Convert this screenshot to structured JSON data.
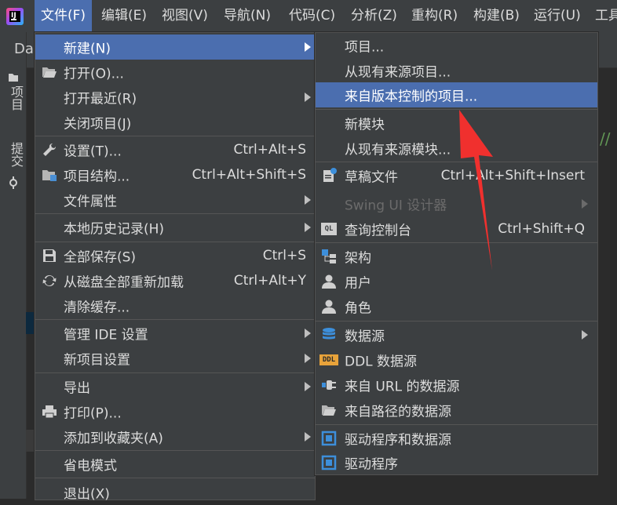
{
  "menubar": {
    "items": [
      "文件(F)",
      "编辑(E)",
      "视图(V)",
      "导航(N)",
      "代码(C)",
      "分析(Z)",
      "重构(R)",
      "构建(B)",
      "运行(U)",
      "工具"
    ]
  },
  "navbar": {
    "text": "Da"
  },
  "left_strip": {
    "tab_project": "项目",
    "tab_commit": "提交"
  },
  "editor": {
    "comment_fragment": "//"
  },
  "file_menu": {
    "items": [
      {
        "label": "新建(N)"
      },
      {
        "label": "打开(O)..."
      },
      {
        "label": "打开最近(R)"
      },
      {
        "label": "关闭项目(J)"
      },
      {
        "label": "设置(T)...",
        "shortcut": "Ctrl+Alt+S"
      },
      {
        "label": "项目结构...",
        "shortcut": "Ctrl+Alt+Shift+S"
      },
      {
        "label": "文件属性"
      },
      {
        "label": "本地历史记录(H)"
      },
      {
        "label": "全部保存(S)",
        "shortcut": "Ctrl+S"
      },
      {
        "label": "从磁盘全部重新加载",
        "shortcut": "Ctrl+Alt+Y"
      },
      {
        "label": "清除缓存..."
      },
      {
        "label": "管理 IDE 设置"
      },
      {
        "label": "新项目设置"
      },
      {
        "label": "导出"
      },
      {
        "label": "打印(P)..."
      },
      {
        "label": "添加到收藏夹(A)"
      },
      {
        "label": "省电模式"
      },
      {
        "label": "退出(X)"
      }
    ]
  },
  "new_menu": {
    "items": [
      {
        "label": "项目..."
      },
      {
        "label": "从现有来源项目..."
      },
      {
        "label": "来自版本控制的项目..."
      },
      {
        "label": "新模块"
      },
      {
        "label": "从现有来源模块..."
      },
      {
        "label": "草稿文件",
        "shortcut": "Ctrl+Alt+Shift+Insert"
      },
      {
        "label": "Swing UI 设计器"
      },
      {
        "label": "查询控制台",
        "shortcut": "Ctrl+Shift+Q"
      },
      {
        "label": "架构"
      },
      {
        "label": "用户"
      },
      {
        "label": "角色"
      },
      {
        "label": "数据源"
      },
      {
        "label": "DDL 数据源"
      },
      {
        "label": "来自 URL 的数据源"
      },
      {
        "label": "来自路径的数据源"
      },
      {
        "label": "驱动程序和数据源"
      },
      {
        "label": "驱动程序"
      }
    ],
    "ql_icon_text": "QL",
    "ddl_icon_text": "DDL"
  },
  "colors": {
    "highlight": "#4b6eaf",
    "menu_bg": "#3c3f41",
    "annotation_arrow": "#f0302e"
  },
  "icons": {
    "open": "folder-open-icon",
    "settings": "wrench-icon",
    "project_structure": "project-structure-icon",
    "save_all": "save-icon",
    "reload": "sync-icon",
    "print": "printer-icon",
    "scratch": "scratch-file-icon",
    "query_console": "query-console-icon",
    "schema": "schema-icon",
    "user": "user-icon",
    "role": "role-icon",
    "datasource": "database-icon",
    "ddl": "ddl-icon",
    "url": "url-datasource-icon",
    "path": "folder-path-icon",
    "drivers": "driver-icon"
  }
}
